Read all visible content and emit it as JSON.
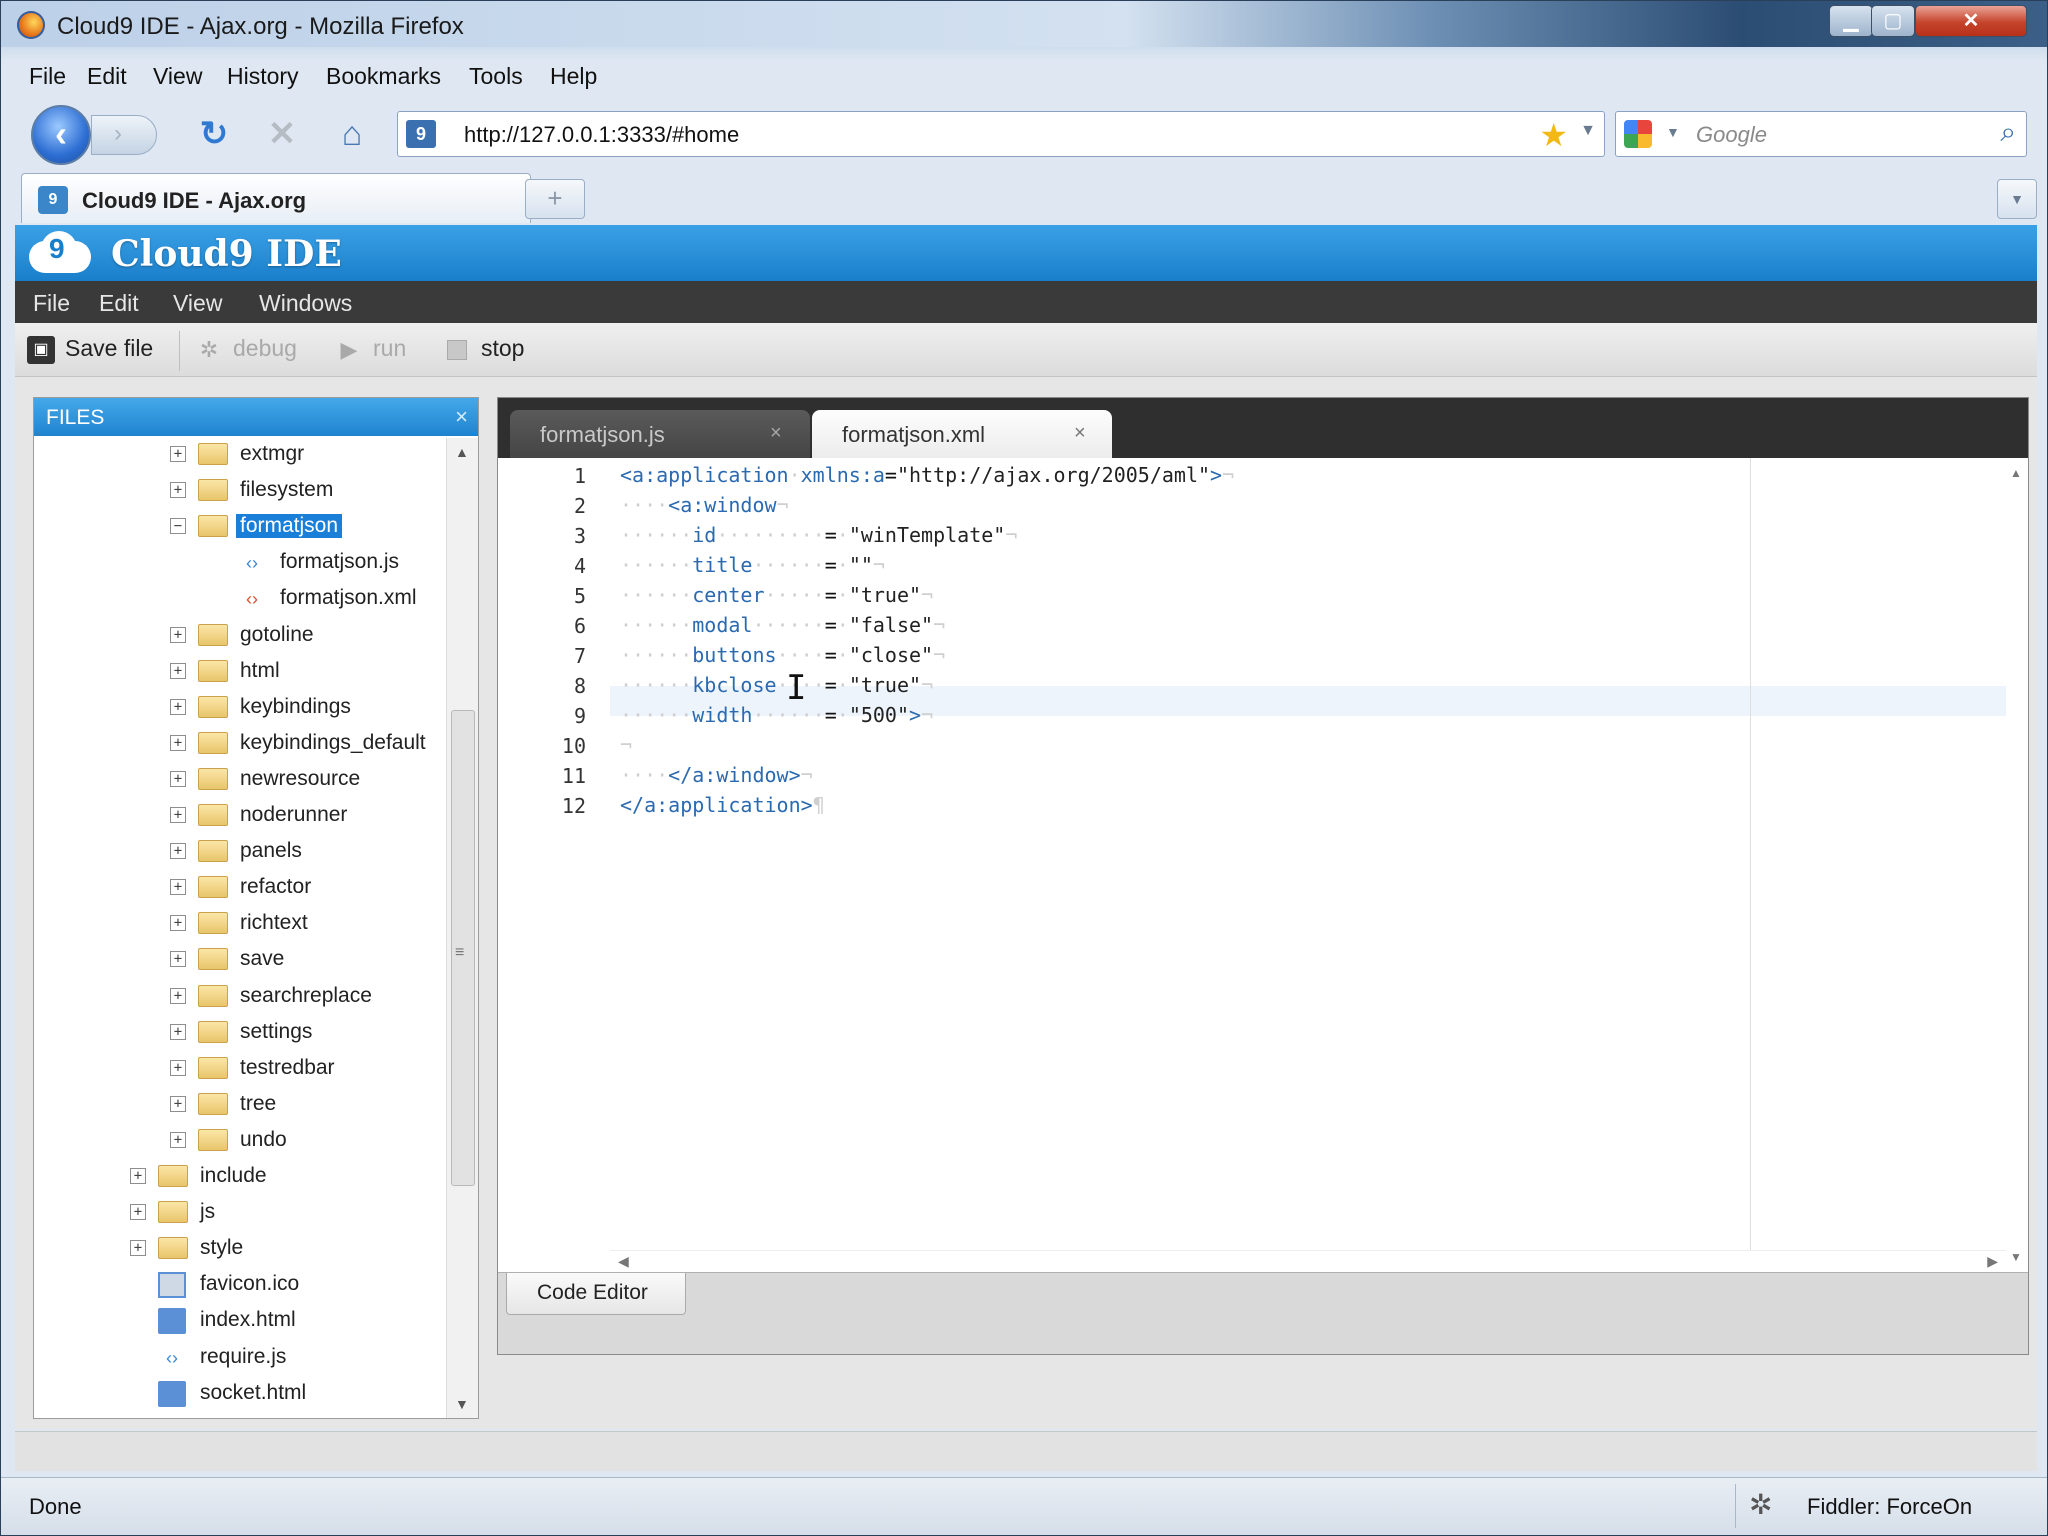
{
  "window": {
    "title": "Cloud9 IDE - Ajax.org - Mozilla Firefox",
    "min_label": "▁",
    "max_label": "▢",
    "close_label": "✕"
  },
  "browser_menu": [
    "File",
    "Edit",
    "View",
    "History",
    "Bookmarks",
    "Tools",
    "Help"
  ],
  "nav": {
    "url": "http://127.0.0.1:3333/#home",
    "search_placeholder": "Google"
  },
  "browser_tab": {
    "label": "Cloud9 IDE - Ajax.org",
    "new_tab": "+"
  },
  "ide": {
    "title": "Cloud9 IDE",
    "menu": [
      "File",
      "Edit",
      "View",
      "Windows"
    ],
    "toolbar": {
      "save": "Save file",
      "debug": "debug",
      "run": "run",
      "stop": "stop"
    }
  },
  "files_panel": {
    "title": "FILES",
    "close": "×",
    "tree": [
      {
        "label": "extmgr",
        "kind": "folder",
        "level": 1,
        "toggle": "+"
      },
      {
        "label": "filesystem",
        "kind": "folder",
        "level": 1,
        "toggle": "+"
      },
      {
        "label": "formatjson",
        "kind": "folder",
        "level": 1,
        "toggle": "−",
        "selected": true
      },
      {
        "label": "formatjson.js",
        "kind": "js",
        "level": 2
      },
      {
        "label": "formatjson.xml",
        "kind": "xml",
        "level": 2
      },
      {
        "label": "gotoline",
        "kind": "folder",
        "level": 1,
        "toggle": "+"
      },
      {
        "label": "html",
        "kind": "folder",
        "level": 1,
        "toggle": "+"
      },
      {
        "label": "keybindings",
        "kind": "folder",
        "level": 1,
        "toggle": "+"
      },
      {
        "label": "keybindings_default",
        "kind": "folder",
        "level": 1,
        "toggle": "+"
      },
      {
        "label": "newresource",
        "kind": "folder",
        "level": 1,
        "toggle": "+"
      },
      {
        "label": "noderunner",
        "kind": "folder",
        "level": 1,
        "toggle": "+"
      },
      {
        "label": "panels",
        "kind": "folder",
        "level": 1,
        "toggle": "+"
      },
      {
        "label": "refactor",
        "kind": "folder",
        "level": 1,
        "toggle": "+"
      },
      {
        "label": "richtext",
        "kind": "folder",
        "level": 1,
        "toggle": "+"
      },
      {
        "label": "save",
        "kind": "folder",
        "level": 1,
        "toggle": "+"
      },
      {
        "label": "searchreplace",
        "kind": "folder",
        "level": 1,
        "toggle": "+"
      },
      {
        "label": "settings",
        "kind": "folder",
        "level": 1,
        "toggle": "+"
      },
      {
        "label": "testredbar",
        "kind": "folder",
        "level": 1,
        "toggle": "+"
      },
      {
        "label": "tree",
        "kind": "folder",
        "level": 1,
        "toggle": "+"
      },
      {
        "label": "undo",
        "kind": "folder",
        "level": 1,
        "toggle": "+"
      },
      {
        "label": "include",
        "kind": "folder",
        "level": 0,
        "toggle": "+"
      },
      {
        "label": "js",
        "kind": "folder",
        "level": 0,
        "toggle": "+"
      },
      {
        "label": "style",
        "kind": "folder",
        "level": 0,
        "toggle": "+"
      },
      {
        "label": "favicon.ico",
        "kind": "ico",
        "level": 0
      },
      {
        "label": "index.html",
        "kind": "html",
        "level": 0
      },
      {
        "label": "require.js",
        "kind": "js",
        "level": 0
      },
      {
        "label": "socket.html",
        "kind": "html",
        "level": 0
      }
    ]
  },
  "editor": {
    "tabs": [
      {
        "label": "formatjson.js",
        "active": false
      },
      {
        "label": "formatjson.xml",
        "active": true
      }
    ],
    "tab_close": "×",
    "bottom_tab": "Code Editor",
    "lines": [
      {
        "n": "1",
        "text": "<a:application xmlns:a=\"http://ajax.org/2005/aml\">"
      },
      {
        "n": "2",
        "text": "    <a:window"
      },
      {
        "n": "3",
        "text": "      id         = \"winTemplate\""
      },
      {
        "n": "4",
        "text": "      title      = \"\""
      },
      {
        "n": "5",
        "text": "      center     = \"true\""
      },
      {
        "n": "6",
        "text": "      modal      = \"false\""
      },
      {
        "n": "7",
        "text": "      buttons    = \"close\""
      },
      {
        "n": "8",
        "text": "      kbclose    = \"true\""
      },
      {
        "n": "9",
        "text": "      width      = \"500\">"
      },
      {
        "n": "10",
        "text": ""
      },
      {
        "n": "11",
        "text": "    </a:window>"
      },
      {
        "n": "12",
        "text": "</a:application>"
      }
    ]
  },
  "status": {
    "text": "Done",
    "fiddler": "Fiddler: ForceOn"
  },
  "colors": {
    "ide_header": "#1a7fcb",
    "selection": "#1a7fd9",
    "xml_tag": "#2a6ab0"
  }
}
